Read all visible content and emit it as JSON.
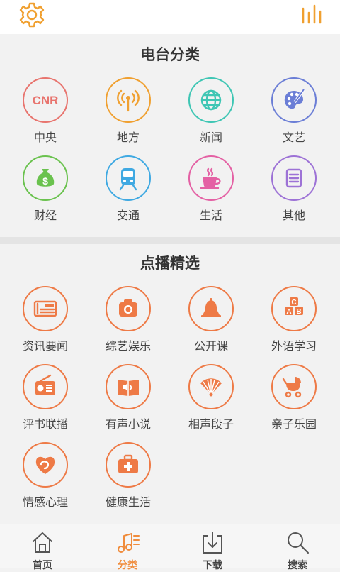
{
  "header": {
    "left_icon": "gear-icon",
    "right_icon": "equalizer-icon"
  },
  "radio_section": {
    "title": "电台分类",
    "items": [
      {
        "label": "中央",
        "icon": "cnr-icon",
        "color": "#e8746e",
        "text": "CNR"
      },
      {
        "label": "地方",
        "icon": "broadcast-icon",
        "color": "#f0a030"
      },
      {
        "label": "新闻",
        "icon": "globe-icon",
        "color": "#3ec6b4"
      },
      {
        "label": "文艺",
        "icon": "palette-icon",
        "color": "#6b7ed6"
      },
      {
        "label": "财经",
        "icon": "money-bag-icon",
        "color": "#6ac24e"
      },
      {
        "label": "交通",
        "icon": "train-icon",
        "color": "#3fa9e2"
      },
      {
        "label": "生活",
        "icon": "coffee-icon",
        "color": "#e461a4"
      },
      {
        "label": "其他",
        "icon": "document-icon",
        "color": "#9d72d6"
      }
    ]
  },
  "vod_section": {
    "title": "点播精选",
    "items": [
      {
        "label": "资讯要闻",
        "icon": "newspaper-icon",
        "color": "#ee7a46"
      },
      {
        "label": "综艺娱乐",
        "icon": "camera-icon",
        "color": "#ee7a46"
      },
      {
        "label": "公开课",
        "icon": "bell-icon",
        "color": "#ee7a46"
      },
      {
        "label": "外语学习",
        "icon": "abc-blocks-icon",
        "color": "#ee7a46"
      },
      {
        "label": "评书联播",
        "icon": "radio-icon",
        "color": "#ee7a46"
      },
      {
        "label": "有声小说",
        "icon": "audio-book-icon",
        "color": "#ee7a46"
      },
      {
        "label": "相声段子",
        "icon": "fan-icon",
        "color": "#ee7a46"
      },
      {
        "label": "亲子乐园",
        "icon": "stroller-icon",
        "color": "#ee7a46"
      },
      {
        "label": "情感心理",
        "icon": "heart-swirl-icon",
        "color": "#ee7a46"
      },
      {
        "label": "健康生活",
        "icon": "medical-kit-icon",
        "color": "#ee7a46"
      }
    ]
  },
  "bottom_nav": {
    "items": [
      {
        "label": "首页",
        "icon": "home-icon",
        "active": false
      },
      {
        "label": "分类",
        "icon": "music-list-icon",
        "active": true
      },
      {
        "label": "下载",
        "icon": "download-icon",
        "active": false
      },
      {
        "label": "搜索",
        "icon": "search-icon",
        "active": false
      }
    ]
  },
  "colors": {
    "accent": "#f08c3c",
    "background": "#f2f2f2"
  }
}
